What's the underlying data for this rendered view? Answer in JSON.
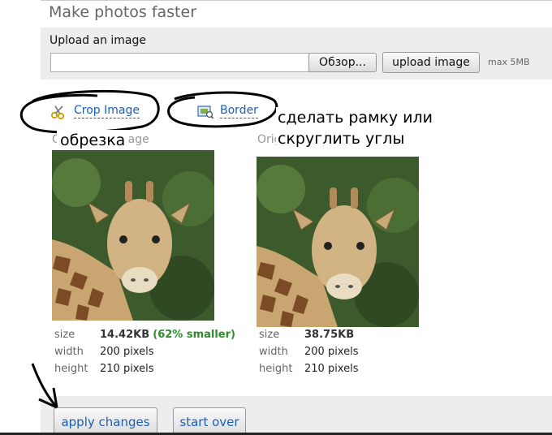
{
  "header": {
    "title": "Make photos faster"
  },
  "upload": {
    "label": "Upload an image",
    "file_value": "",
    "browse_label": "Обзор...",
    "upload_label": "upload image",
    "max_size": "max 5MB"
  },
  "tools": {
    "crop_label": "Crop Image",
    "border_label": "Border"
  },
  "annotations": {
    "crop_note": "обрезка",
    "border_note_line1": "сделать рамку или",
    "border_note_line2": "скруглить углы"
  },
  "images": {
    "left": {
      "caption": "Optimized image",
      "size_key": "size",
      "size_value": "14.42KB",
      "size_note": "(62% smaller)",
      "width_key": "width",
      "width_value": "200 pixels",
      "height_key": "height",
      "height_value": "210 pixels"
    },
    "right": {
      "caption": "Original image",
      "size_key": "size",
      "size_value": "38.75KB",
      "width_key": "width",
      "width_value": "200 pixels",
      "height_key": "height",
      "height_value": "210 pixels"
    }
  },
  "actions": {
    "apply_label": "apply changes",
    "start_over_label": "start over"
  },
  "colors": {
    "link": "#1a5fb4",
    "savings": "#2e8b2e",
    "panel": "#ededed"
  }
}
